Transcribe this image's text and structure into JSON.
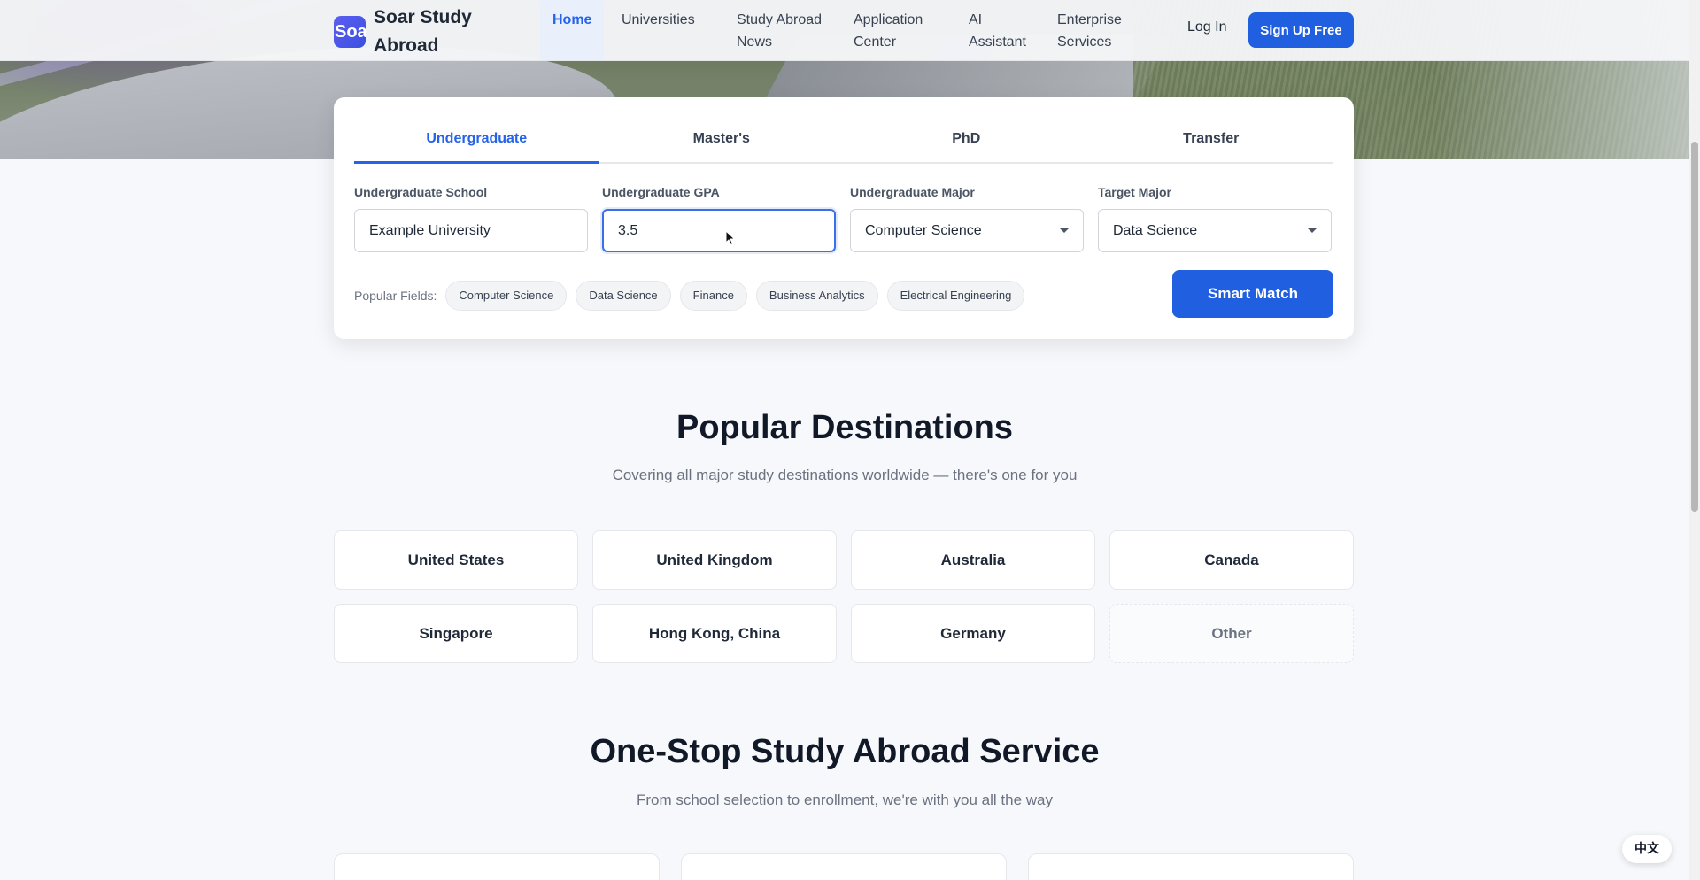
{
  "brand": {
    "logo_text": "Soar",
    "name": "Soar Study Abroad"
  },
  "nav": {
    "links": [
      {
        "label": "Home",
        "active": true
      },
      {
        "label": "Universities"
      },
      {
        "label": "Study Abroad News"
      },
      {
        "label": "Application Center"
      },
      {
        "label": "AI Assistant"
      },
      {
        "label": "Enterprise Services"
      }
    ],
    "login": "Log In",
    "signup": "Sign Up Free"
  },
  "search": {
    "tabs": [
      "Undergraduate",
      "Master's",
      "PhD",
      "Transfer"
    ],
    "active_tab": "Undergraduate",
    "fields": {
      "school": {
        "label": "Undergraduate School",
        "value": "Example University"
      },
      "gpa": {
        "label": "Undergraduate GPA",
        "value": "3.5"
      },
      "major": {
        "label": "Undergraduate Major",
        "value": "Computer Science"
      },
      "target": {
        "label": "Target Major",
        "value": "Data Science"
      }
    },
    "popular_label": "Popular Fields:",
    "popular_fields": [
      "Computer Science",
      "Data Science",
      "Finance",
      "Business Analytics",
      "Electrical Engineering"
    ],
    "submit": "Smart Match"
  },
  "destinations": {
    "title": "Popular Destinations",
    "subtitle": "Covering all major study destinations worldwide — there's one for you",
    "items": [
      "United States",
      "United Kingdom",
      "Australia",
      "Canada",
      "Singapore",
      "Hong Kong, China",
      "Germany",
      "Other"
    ]
  },
  "services": {
    "title": "One-Stop Study Abroad Service",
    "subtitle": "From school selection to enrollment, we're with you all the way"
  },
  "language_toggle": "中文",
  "colors": {
    "primary": "#1f5fe0",
    "accent_text": "#2563eb"
  }
}
